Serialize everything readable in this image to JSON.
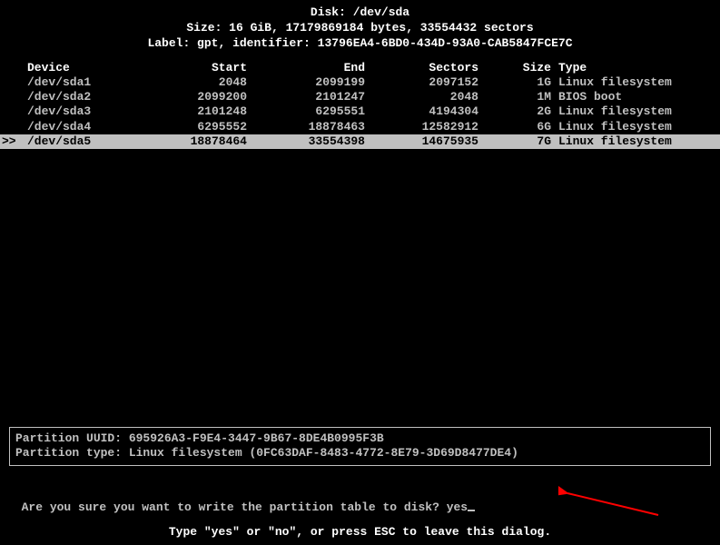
{
  "header": {
    "disk_label": "Disk: /dev/sda",
    "size_line": "Size: 16 GiB, 17179869184 bytes, 33554432 sectors",
    "label_line": "Label: gpt, identifier: 13796EA4-6BD0-434D-93A0-CAB5847FCE7C"
  },
  "columns": {
    "device": "Device",
    "start": "Start",
    "end": "End",
    "sectors": "Sectors",
    "size": "Size",
    "type": "Type"
  },
  "partitions": [
    {
      "marker": "",
      "device": "/dev/sda1",
      "start": "2048",
      "end": "2099199",
      "sectors": "2097152",
      "size": "1G",
      "type": "Linux filesystem",
      "selected": false
    },
    {
      "marker": "",
      "device": "/dev/sda2",
      "start": "2099200",
      "end": "2101247",
      "sectors": "2048",
      "size": "1M",
      "type": "BIOS boot",
      "selected": false
    },
    {
      "marker": "",
      "device": "/dev/sda3",
      "start": "2101248",
      "end": "6295551",
      "sectors": "4194304",
      "size": "2G",
      "type": "Linux filesystem",
      "selected": false
    },
    {
      "marker": "",
      "device": "/dev/sda4",
      "start": "6295552",
      "end": "18878463",
      "sectors": "12582912",
      "size": "6G",
      "type": "Linux filesystem",
      "selected": false
    },
    {
      "marker": ">>",
      "device": "/dev/sda5",
      "start": "18878464",
      "end": "33554398",
      "sectors": "14675935",
      "size": "7G",
      "type": "Linux filesystem",
      "selected": true
    }
  ],
  "info": {
    "uuid_line": "Partition UUID: 695926A3-F9E4-3447-9B67-8DE4B0995F3B",
    "type_line": "Partition type: Linux filesystem (0FC63DAF-8483-4772-8E79-3D69D8477DE4)"
  },
  "prompt": {
    "question": "Are you sure you want to write the partition table to disk? ",
    "input_value": "yes"
  },
  "hint": "Type \"yes\" or \"no\", or press ESC to leave this dialog."
}
